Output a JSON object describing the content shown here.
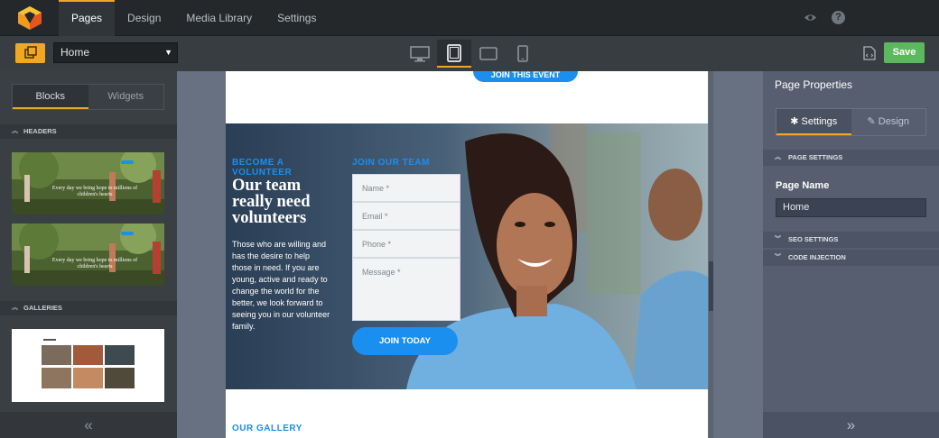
{
  "topnav": {
    "tabs": [
      "Pages",
      "Design",
      "Media Library",
      "Settings"
    ]
  },
  "toolbar": {
    "page_select_value": "Home",
    "save_label": "Save",
    "devices": [
      "desktop-icon",
      "tablet-icon",
      "tablet-landscape-icon",
      "mobile-icon"
    ]
  },
  "left_panel": {
    "tabs": [
      "Blocks",
      "Widgets"
    ],
    "sections": [
      "HEADERS",
      "GALLERIES"
    ],
    "header_thumb_text": "Every day we bring hope to millions of children's hearts"
  },
  "canvas": {
    "join_event_label": "JOIN THIS EVENT",
    "become_label": "BECOME A VOLUNTEER",
    "title": "Our team really need volunteers",
    "description": "Those who are willing and has the desire to help those in need. If you are young, active and ready to change the world for the better, we look forward to seeing you in our volunteer family.",
    "join_team_label": "JOIN OUR TEAM",
    "form": {
      "name_placeholder": "Name *",
      "email_placeholder": "Email *",
      "phone_placeholder": "Phone *",
      "message_placeholder": "Message *"
    },
    "join_button": "JOIN TODAY",
    "gallery_title": "OUR GALLERY"
  },
  "right_panel": {
    "title": "Page Properties",
    "tabs": [
      "Settings",
      "Design"
    ],
    "sections": [
      "PAGE SETTINGS",
      "SEO SETTINGS",
      "CODE INJECTION"
    ],
    "page_name_label": "Page Name",
    "page_name_value": "Home"
  },
  "colors": {
    "accent": "#f2a623",
    "save": "#5cb85c",
    "brand_blue": "#1a8fef"
  }
}
